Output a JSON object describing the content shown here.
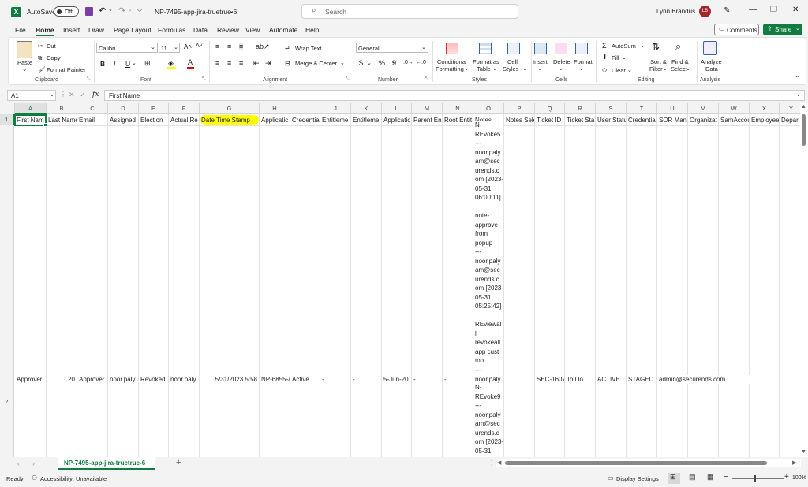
{
  "titlebar": {
    "autosave_label": "AutoSave",
    "autosave_state": "Off",
    "filename": "NP-7495-app-jira-truetrue-6",
    "search_placeholder": "Search",
    "user_name": "Lynn Brandus",
    "user_initials": "LB"
  },
  "menu": {
    "tabs": [
      "File",
      "Home",
      "Insert",
      "Draw",
      "Page Layout",
      "Formulas",
      "Data",
      "Review",
      "View",
      "Automate",
      "Help"
    ],
    "comments_label": "Comments",
    "share_label": "Share"
  },
  "ribbon": {
    "clipboard": {
      "paste": "Paste",
      "cut": "Cut",
      "copy": "Copy",
      "format_painter": "Format Painter",
      "group": "Clipboard"
    },
    "font": {
      "name": "Calibri",
      "size": "11",
      "bold": "B",
      "italic": "I",
      "underline": "U",
      "group": "Font"
    },
    "alignment": {
      "wrap": "Wrap Text",
      "merge": "Merge & Center",
      "group": "Alignment"
    },
    "number": {
      "format": "General",
      "currency": "$",
      "percent": "%",
      "comma": "9",
      "group": "Number"
    },
    "styles": {
      "conditional_1": "Conditional",
      "conditional_2": "Formatting",
      "format_table_1": "Format as",
      "format_table_2": "Table",
      "cell_styles_1": "Cell",
      "cell_styles_2": "Styles",
      "group": "Styles"
    },
    "cells": {
      "insert": "Insert",
      "delete": "Delete",
      "format": "Format",
      "group": "Cells"
    },
    "editing": {
      "autosum": "AutoSum",
      "fill": "Fill",
      "clear": "Clear",
      "sort_1": "Sort &",
      "sort_2": "Filter",
      "find_1": "Find &",
      "find_2": "Select",
      "group": "Editing"
    },
    "analysis": {
      "analyze_1": "Analyze",
      "analyze_2": "Data",
      "group": "Analysis"
    }
  },
  "formula": {
    "name_box": "A1",
    "fx": "fx",
    "content": "First Name"
  },
  "columns": [
    "A",
    "B",
    "C",
    "D",
    "E",
    "F",
    "G",
    "H",
    "I",
    "J",
    "K",
    "L",
    "M",
    "N",
    "O",
    "P",
    "Q",
    "R",
    "S",
    "T",
    "U",
    "V",
    "W",
    "X",
    "Y"
  ],
  "headers": [
    "First Nam",
    "Last Name",
    "Email",
    "Assigned",
    "Election",
    "Actual Re",
    "Date Time Stamp",
    "Applicatic",
    "Credentia",
    "Entitleme",
    "Entitleme",
    "Applicatic",
    "Parent En",
    "Root Entit",
    "Notes",
    "Notes Sele",
    "Ticket ID",
    "Ticket Sta",
    "User Statu",
    "Credentia",
    "SOR Mana",
    "Organizat",
    "SamAccou",
    "Employee",
    "Depar"
  ],
  "row2": [
    "Approver",
    "20",
    "Approver.",
    "noor.paly",
    "Revoked",
    "noor.paly",
    "5/31/2023 5:58",
    "NP-6855-a",
    "Active",
    "-",
    "-",
    "5-Jun-20",
    "-",
    "-",
    "noor.paly",
    "",
    "SEC-1607",
    "To Do",
    "ACTIVE",
    "STAGED",
    "admin@securends.com",
    "",
    "",
    "",
    ""
  ],
  "notes_row1": [
    "N-",
    "REvoke5",
    "---",
    "noor.paly",
    "am@sec",
    "urends.c",
    "om [2023-",
    "05-31",
    "06:00:11]",
    "",
    "note-",
    "approve",
    "from",
    "popup",
    "---",
    "noor.paly",
    "am@sec",
    "urends.c",
    "om [2023-",
    "05-31",
    "05:25:42]",
    "",
    "REviewal",
    "l",
    "revokeall",
    "app cust",
    "top",
    "---"
  ],
  "notes_row3": [
    "N-",
    "REvoke9",
    "---",
    "noor.paly",
    "am@sec",
    "urends.c",
    "om [2023-",
    "05-31"
  ],
  "row_numbers": [
    "1",
    "2"
  ],
  "sheet": {
    "tab_name": "NP-7495-app-jira-truetrue-6"
  },
  "status": {
    "ready": "Ready",
    "accessibility": "Accessibility: Unavailable",
    "display_settings": "Display Settings",
    "zoom": "100%"
  },
  "colors": {
    "accent_green": "#107c41",
    "highlight_yellow": "#ffff00",
    "grid_line": "#e2e2e2"
  }
}
